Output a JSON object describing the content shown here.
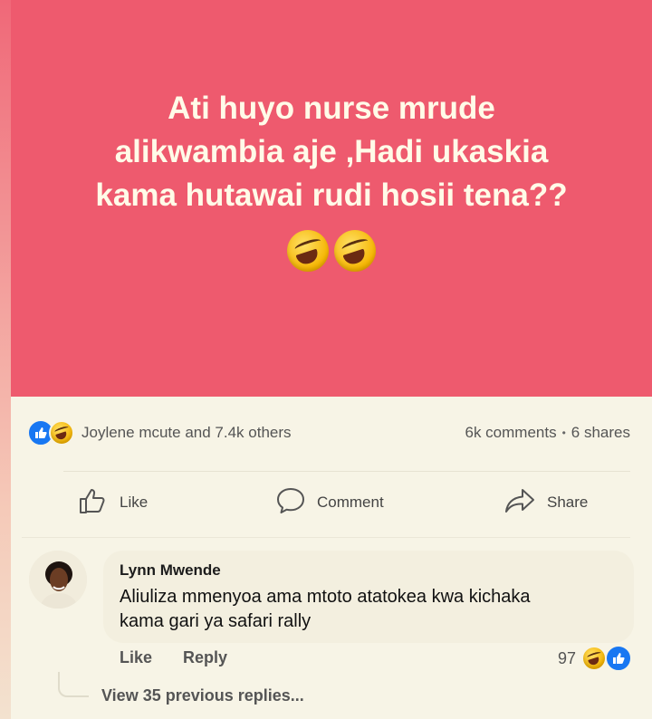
{
  "post": {
    "text": "Ati huyo nurse mrude\nalikwambia aje ,Hadi ukaskia\nkama hutawai rudi hosii tena??",
    "emoji": [
      "rolling-on-floor-laughing",
      "rolling-on-floor-laughing"
    ],
    "background_color": "#ee5a6e"
  },
  "reactions": {
    "summary": "Joylene mcute and 7.4k others",
    "icons": [
      "like-icon",
      "laugh-icon"
    ]
  },
  "stats": {
    "comments": "6k comments",
    "separator": "•",
    "shares": "6 shares"
  },
  "actions": {
    "like": "Like",
    "comment": "Comment",
    "share": "Share"
  },
  "comment": {
    "author": "Lynn Mwende",
    "text": "Aliuliza mmenyoa ama mtoto atatokea kwa kichaka\nkama gari ya safari rally",
    "like_label": "Like",
    "reply_label": "Reply",
    "reaction_count": "97",
    "view_replies": "View 35 previous replies..."
  },
  "colors": {
    "accent_blue": "#1877f2",
    "page_bg": "#f7f4e6"
  }
}
